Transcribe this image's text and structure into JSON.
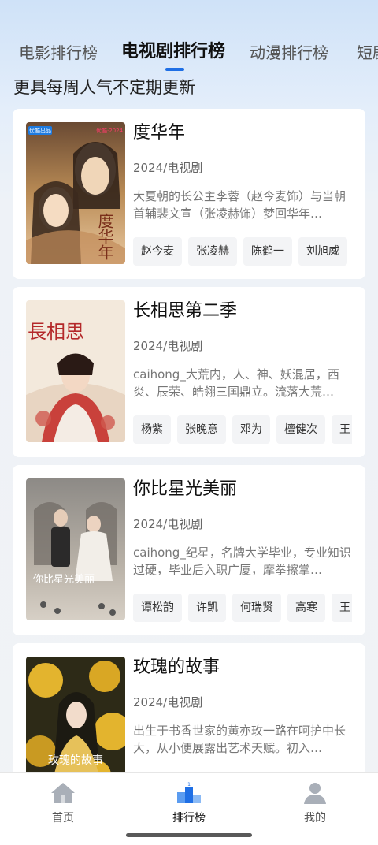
{
  "tabs": [
    {
      "label": "电影排行榜"
    },
    {
      "label": "电视剧排行榜"
    },
    {
      "label": "动漫排行榜"
    },
    {
      "label": "短剧"
    }
  ],
  "active_tab": "电视剧排行榜",
  "subtitle": "更具每周人气不定期更新",
  "cards": [
    {
      "title": "度华年",
      "meta": "2024/电视剧",
      "description": "大夏朝的长公主李蓉（赵今麦饰）与当朝首辅裴文宣（张凌赫饰）梦回华年…",
      "cast": [
        "赵今麦",
        "张凌赫",
        "陈鹤一",
        "刘旭威"
      ],
      "poster_badge": "优酷出品",
      "poster_brand": "优酷·2024",
      "poster_text": "度华年",
      "poster_colors": [
        "#b98b55",
        "#3c2a1e",
        "#e9c8a0"
      ]
    },
    {
      "title": "长相思第二季",
      "meta": "2024/电视剧",
      "description": "caihong_大荒内，人、神、妖混居，西炎、辰荣、皓翎三国鼎立。流落大荒…",
      "cast": [
        "杨紫",
        "张晚意",
        "邓为",
        "檀健次",
        "王"
      ],
      "poster_text": "長相思",
      "poster_colors": [
        "#f3e9dc",
        "#c9413b",
        "#e8d5c2"
      ]
    },
    {
      "title": "你比星光美丽",
      "meta": "2024/电视剧",
      "description": "caihong_纪星，名牌大学毕业，专业知识过硬，毕业后入职广厦，摩拳擦掌…",
      "cast": [
        "谭松韵",
        "许凯",
        "何瑞贤",
        "高寒",
        "王"
      ],
      "poster_text": "你比星光美丽",
      "poster_colors": [
        "#8d8a86",
        "#d7d0c6",
        "#4c4a48"
      ]
    },
    {
      "title": "玫瑰的故事",
      "meta": "2024/电视剧",
      "description": "出生于书香世家的黄亦玫一路在呵护中长大，从小便展露出艺术天赋。初入…",
      "cast": [],
      "poster_text": "玫瑰的故事",
      "poster_colors": [
        "#2d2a17",
        "#e3b42e",
        "#6b5a22"
      ]
    }
  ],
  "bottom_nav": [
    {
      "label": "首页",
      "icon": "home-icon"
    },
    {
      "label": "排行榜",
      "icon": "ranking-icon"
    },
    {
      "label": "我的",
      "icon": "profile-icon"
    }
  ],
  "active_nav": "排行榜",
  "accent_color": "#1f6fe5"
}
